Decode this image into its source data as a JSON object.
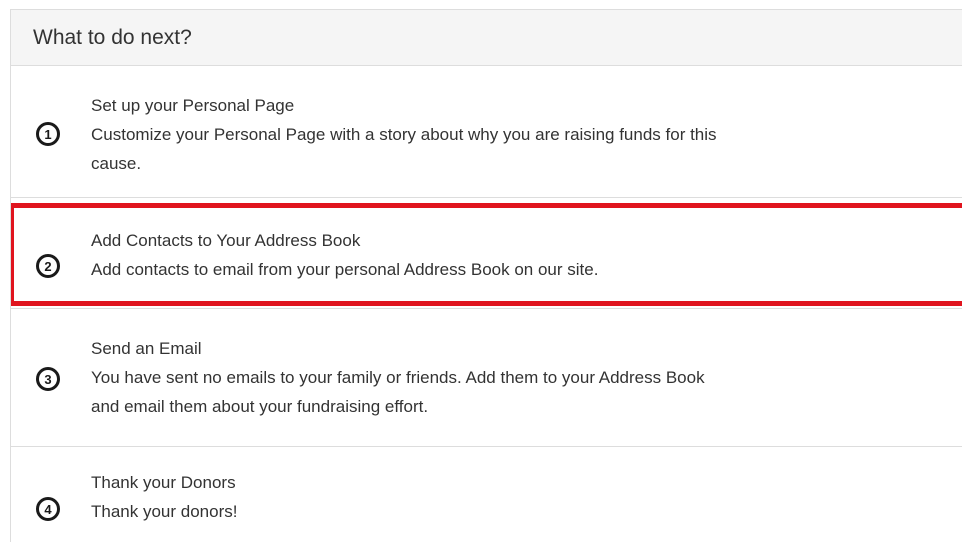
{
  "panel": {
    "title": "What to do next?"
  },
  "steps": [
    {
      "number": "1",
      "title": "Set up your Personal Page",
      "description_line1": "Customize your Personal Page with a story about why you are raising funds for this",
      "description_line2": "cause."
    },
    {
      "number": "2",
      "title": "Add Contacts to Your Address Book",
      "description_line1": "Add contacts to email from your personal Address Book on our site.",
      "highlighted": true,
      "highlight_color": "#e0141e"
    },
    {
      "number": "3",
      "title": "Send an Email",
      "description_line1": "You have sent no emails to your family or friends. Add them to your Address Book",
      "description_line2": "and email them about your fundraising effort."
    },
    {
      "number": "4",
      "title": "Thank your Donors",
      "description_line1": "Thank your donors!"
    }
  ]
}
